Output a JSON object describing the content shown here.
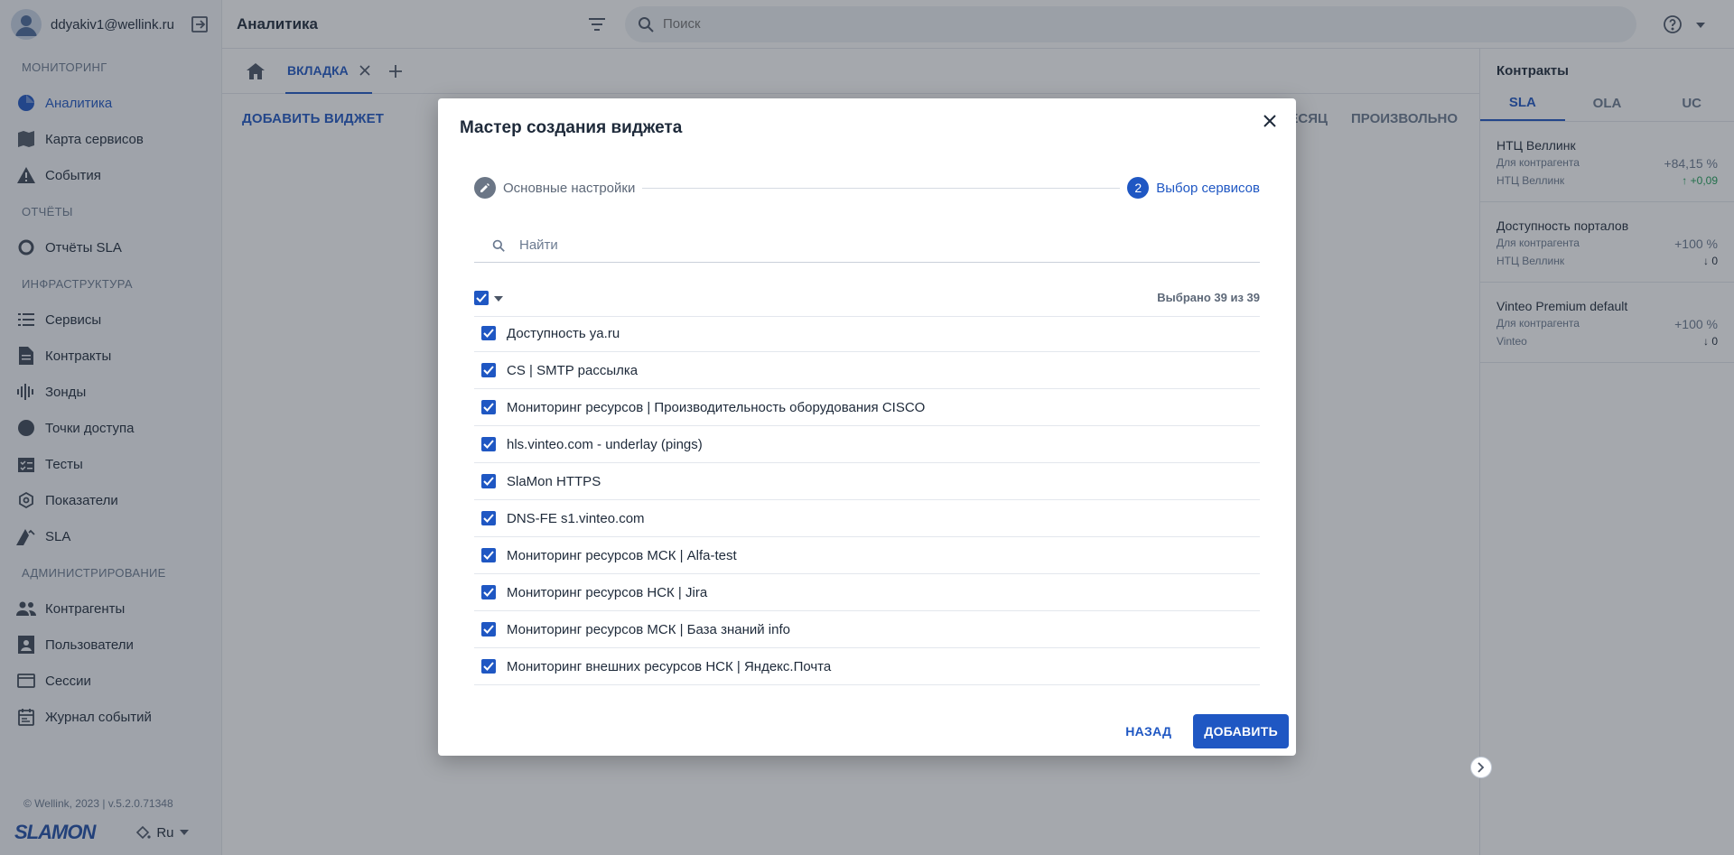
{
  "user": {
    "email": "ddyakiv1@wellink.ru"
  },
  "header": {
    "title": "Аналитика",
    "search_placeholder": "Поиск"
  },
  "sidebar": {
    "sections": [
      {
        "title": "МОНИТОРИНГ",
        "items": [
          {
            "label": "Аналитика",
            "icon": "pie-chart-icon",
            "active": true
          },
          {
            "label": "Карта сервисов",
            "icon": "map-icon"
          },
          {
            "label": "События",
            "icon": "warning-icon"
          }
        ]
      },
      {
        "title": "ОТЧЁТЫ",
        "items": [
          {
            "label": "Отчёты SLA",
            "icon": "donut-icon"
          }
        ]
      },
      {
        "title": "ИНФРАСТРУКТУРА",
        "items": [
          {
            "label": "Сервисы",
            "icon": "list-icon"
          },
          {
            "label": "Контракты",
            "icon": "document-icon"
          },
          {
            "label": "Зонды",
            "icon": "signal-icon"
          },
          {
            "label": "Точки доступа",
            "icon": "circle-icon"
          },
          {
            "label": "Тесты",
            "icon": "checklist-icon"
          },
          {
            "label": "Показатели",
            "icon": "metrics-icon"
          },
          {
            "label": "SLA",
            "icon": "sla-icon"
          }
        ]
      },
      {
        "title": "АДМИНИСТРИРОВАНИЕ",
        "items": [
          {
            "label": "Контрагенты",
            "icon": "people-icon"
          },
          {
            "label": "Пользователи",
            "icon": "user-card-icon"
          },
          {
            "label": "Сессии",
            "icon": "window-icon"
          },
          {
            "label": "Журнал событий",
            "icon": "calendar-icon"
          }
        ]
      }
    ],
    "copyright": "© Wellink, 2023 | v.5.2.0.71348",
    "logo": "SLAMON",
    "language": "Ru"
  },
  "tabs": {
    "active_label": "ВКЛАДКА"
  },
  "toolbar": {
    "add_widget": "ДОБАВИТЬ ВИДЖЕТ",
    "period_month": "ЕСЯЦ",
    "period_custom": "ПРОИЗВОЛЬНО"
  },
  "right_panel": {
    "title": "Контракты",
    "tabs": [
      "SLA",
      "OLA",
      "UC"
    ],
    "contracts": [
      {
        "name": "НТЦ Веллинк",
        "sub1": "Для контрагента",
        "value": "+84,15 %",
        "sub2": "НТЦ Веллинк",
        "delta": "↑ +0,09",
        "delta_dir": "up"
      },
      {
        "name": "Доступность порталов",
        "sub1": "Для контрагента",
        "value": "+100 %",
        "sub2": "НТЦ Веллинк",
        "delta": "↓ 0",
        "delta_dir": "down"
      },
      {
        "name": "Vinteo Premium default",
        "sub1": "Для контрагента",
        "value": "+100 %",
        "sub2": "Vinteo",
        "delta": "↓ 0",
        "delta_dir": "down"
      }
    ]
  },
  "modal": {
    "title": "Мастер создания виджета",
    "steps": [
      {
        "label": "Основные настройки",
        "state": "done"
      },
      {
        "number": "2",
        "label": "Выбор сервисов",
        "state": "current"
      }
    ],
    "search_placeholder": "Найти",
    "selected_count": "Выбрано 39 из 39",
    "services": [
      "Доступность ya.ru",
      "CS | SMTP рассылка",
      "Мониторинг ресурсов | Производительность оборудования CISCO",
      "hls.vinteo.com - underlay (pings)",
      "SlaMon HTTPS",
      "DNS-FE s1.vinteo.com",
      "Мониторинг ресурсов МСК | Alfa-test",
      "Мониторинг ресурсов НСК | Jira",
      "Мониторинг ресурсов МСК | База знаний info",
      "Мониторинг внешних ресурсов НСК | Яндекс.Почта"
    ],
    "back_label": "НАЗАД",
    "add_label": "ДОБАВИТЬ"
  },
  "colors": {
    "accent": "#1f57c3",
    "overlay": "rgba(40,48,60,0.42)"
  }
}
